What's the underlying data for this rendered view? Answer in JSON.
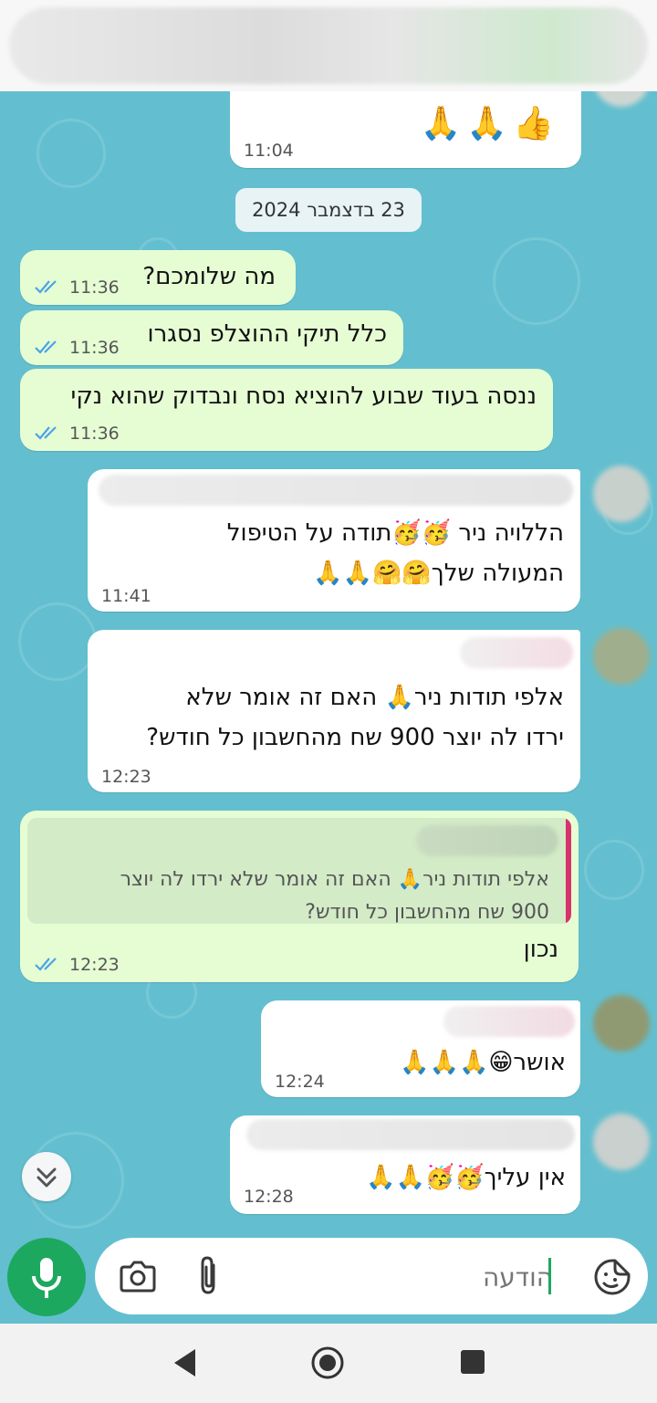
{
  "date_separator": "23 בדצמבר 2024",
  "messages": [
    {
      "emojis": "👍🙏🙏",
      "time": "11:04"
    },
    {
      "text": "מה שלומכם?",
      "time": "11:36"
    },
    {
      "text": "כלל תיקי ההוצלפ נסגרו",
      "time": "11:36"
    },
    {
      "text": "ננסה בעוד שבוע להוציא נסח ונבדוק שהוא נקי",
      "time": "11:36"
    },
    {
      "text": "הללויה ניר 🥳🥳תודה על הטיפול\nהמעולה שלך🤗🤗🙏🙏",
      "time": "11:41"
    },
    {
      "text": "אלפי תודות ניר🙏 האם זה אומר שלא\nירדו לה יוצר 900 שח מהחשבון כל חודש?",
      "time": "12:23"
    },
    {
      "quote": "אלפי תודות ניר🙏 האם זה אומר שלא ירדו לה יוצר\n900 שח מהחשבון כל חודש?",
      "text": "נכון",
      "time": "12:23"
    },
    {
      "text": "אושר😁🙏🙏🙏",
      "time": "12:24"
    },
    {
      "text": "אין עליך🥳🥳🙏🙏",
      "time": "12:28"
    }
  ],
  "composer": {
    "placeholder": "הודעה"
  },
  "icons": {
    "sticker": "sticker-icon",
    "attach": "paperclip-icon",
    "camera": "camera-icon",
    "mic": "mic-icon",
    "scroll": "double-chevron-down-icon",
    "read": "double-check-icon",
    "nav_back": "triangle-back-icon",
    "nav_home": "circle-home-icon",
    "nav_recents": "square-recents-icon"
  },
  "colors": {
    "chat_bg": "#63bfcf",
    "outgoing": "#e6fdd4",
    "incoming": "#ffffff",
    "accent": "#1da85f",
    "ticks": "#4aa3e6",
    "quote_bar": "#d6336c"
  }
}
